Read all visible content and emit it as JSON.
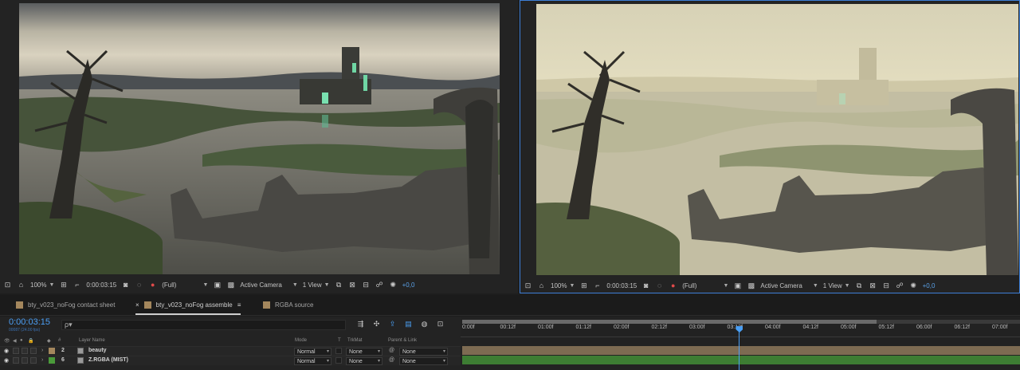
{
  "viewers": [
    {
      "zoom": "100%",
      "timecode": "0:00:03:15",
      "resolution": "(Full)",
      "camera": "Active Camera",
      "views": "1 View",
      "exposure": "+0,0"
    },
    {
      "zoom": "100%",
      "timecode": "0:00:03:15",
      "resolution": "(Full)",
      "camera": "Active Camera",
      "views": "1 View",
      "exposure": "+0,0"
    }
  ],
  "tabs": [
    {
      "label": "bty_v023_noFog contact sheet",
      "active": false
    },
    {
      "label": "bty_v023_noFog assemble",
      "active": true
    },
    {
      "label": "RGBA source",
      "active": false
    }
  ],
  "tab_close": "×",
  "tab_menu": "≡",
  "timeline": {
    "current_time": "0:00:03:15",
    "frame_info": "00087 (24.00 fps)",
    "search_placeholder": "ρ▾",
    "columns": {
      "layer_name": "Layer Name",
      "mode": "Mode",
      "t": "T",
      "trkmat": "TrkMat",
      "parent": "Parent & Link"
    },
    "layers": [
      {
        "num": "2",
        "name": "beauty",
        "mode": "Normal",
        "trkmat": "None",
        "parent": "None",
        "label_color": "#a4875d",
        "bar_color": "#7d6b52"
      },
      {
        "num": "6",
        "name": "Z.RGBA (MIST)",
        "mode": "Normal",
        "trkmat": "None",
        "parent": "None",
        "label_color": "#4a9a3a",
        "bar_color": "#3d7d33"
      }
    ],
    "ruler": [
      "0:00f",
      "00:12f",
      "01:00f",
      "01:12f",
      "02:00f",
      "02:12f",
      "03:00f",
      "03:12f",
      "04:00f",
      "04:12f",
      "05:00f",
      "05:12f",
      "06:00f",
      "06:12f",
      "07:00f"
    ],
    "playhead_seconds": 3.625,
    "duration_seconds": 7.5
  }
}
